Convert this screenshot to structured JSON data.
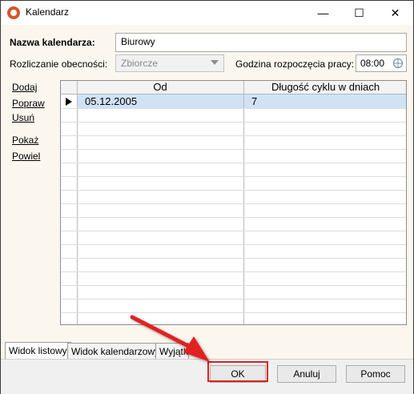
{
  "window": {
    "title": "Kalendarz",
    "controls": {
      "minimize": "—",
      "maximize": "☐",
      "close": "✕"
    }
  },
  "form": {
    "name_label": "Nazwa kalendarza:",
    "name_value": "Biurowy",
    "attendance_label": "Rozliczanie obecności:",
    "attendance_value": "Zbiorcze",
    "start_time_label": "Godzina rozpoczęcia pracy:",
    "start_time_value": "08:00"
  },
  "actions": [
    "Dodaj",
    "Popraw",
    "Usuń",
    "Pokaż",
    "Powiel"
  ],
  "grid": {
    "columns": [
      "Od",
      "Długość cyklu w dniach"
    ],
    "rows": [
      {
        "from": "05.12.2005",
        "cycle_length": "7",
        "selected": true
      }
    ]
  },
  "tabs": [
    "Widok listowy",
    "Widok kalendarzowy",
    "Wyjątki"
  ],
  "buttons": {
    "ok": "OK",
    "cancel": "Anuluj",
    "help": "Pomoc"
  },
  "colors": {
    "selection": "#cfe3f5",
    "highlight": "#e02020",
    "annotation_arrow": "#e02020"
  }
}
